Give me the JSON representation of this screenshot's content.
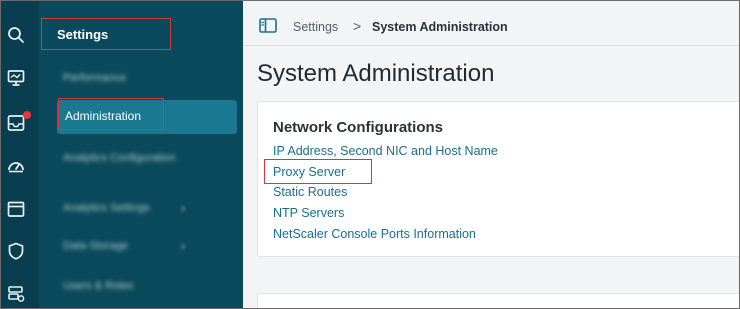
{
  "rail": {
    "icons": [
      "search-icon",
      "monitor-icon",
      "inbox-icon",
      "dashboard-gauge-icon",
      "calendar-icon",
      "shield-icon",
      "database-settings-icon"
    ]
  },
  "sidebar": {
    "title": "Settings",
    "items": [
      {
        "label": "Performance",
        "blurred": true
      },
      {
        "label": "Administration",
        "active": true
      },
      {
        "label": "Analytics Configuration",
        "blurred": true
      },
      {
        "label": "Analytics Settings",
        "blurred": true,
        "has_children": true
      },
      {
        "label": "Data Storage",
        "blurred": true,
        "has_children": true
      },
      {
        "label": "Users & Roles",
        "blurred": true
      }
    ]
  },
  "breadcrumb": {
    "parent": "Settings",
    "separator": ">",
    "current": "System Administration"
  },
  "page": {
    "title": "System Administration"
  },
  "network_card": {
    "title": "Network Configurations",
    "links": [
      "IP Address, Second NIC and Host Name",
      "Proxy Server",
      "Static Routes",
      "NTP Servers",
      "NetScaler Console Ports Information"
    ]
  },
  "colors": {
    "rail_bg": "#083e4f",
    "sidebar_bg": "#0a4a5c",
    "active_item_bg": "#1a7891",
    "link": "#1a6f8f",
    "highlight_box": "#d23a3a",
    "notification_dot": "#e8363d"
  }
}
